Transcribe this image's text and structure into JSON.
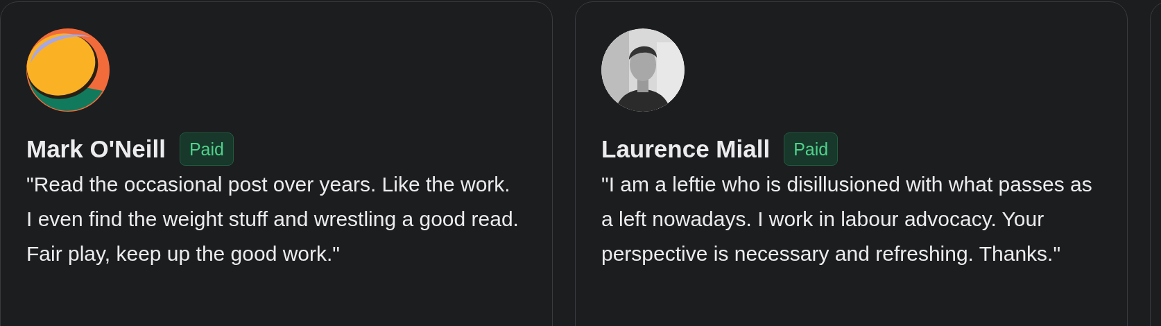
{
  "cards": [
    {
      "kind": "testimonial",
      "avatar": {
        "kind": "logo"
      },
      "name": "Mark O'Neill",
      "badge": "Paid",
      "quote": "\"Read the occasional post over years. Like the work. I even find the weight stuff and wrestling a good read. Fair play, keep up the good work.\""
    },
    {
      "kind": "testimonial",
      "name": "Laurence Miall",
      "badge": "Paid",
      "quote": "\"I am a leftie who is disillusioned with what passes as a left nowadays. I work in labour advocacy. Your perspective is necessary and refreshing. Thanks.\""
    },
    {
      "kind": "blank"
    }
  ]
}
